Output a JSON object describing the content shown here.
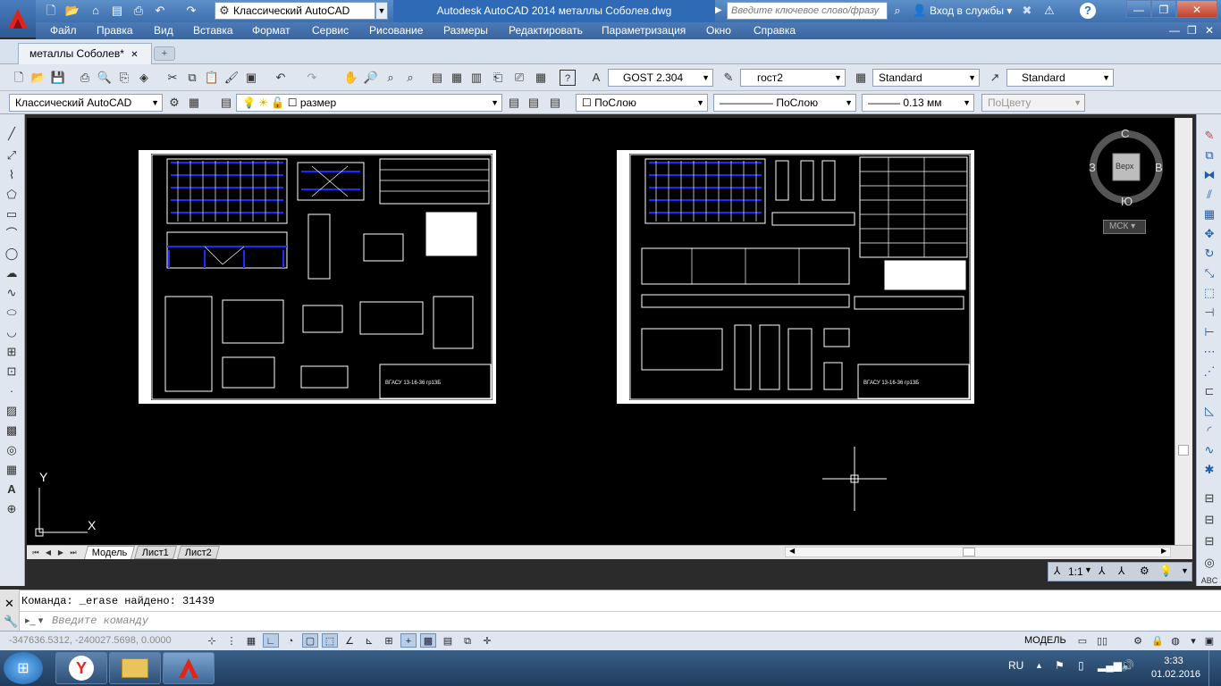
{
  "titlebar": {
    "workspace": "Классический AutoCAD",
    "app_title": "Autodesk AutoCAD 2014    металлы Соболев.dwg",
    "search_placeholder": "Введите ключевое слово/фразу",
    "login": "Вход в службы",
    "help": "?"
  },
  "menu": [
    "Файл",
    "Правка",
    "Вид",
    "Вставка",
    "Формат",
    "Сервис",
    "Рисование",
    "Размеры",
    "Редактировать",
    "Параметризация",
    "Окно",
    "Справка"
  ],
  "doc_tab": "металлы Соболев*",
  "toolbar1": {
    "text_style": "GOST 2.304",
    "dim_style": "гост2",
    "table_style": "Standard",
    "mleader_style": "Standard"
  },
  "toolbar2": {
    "workspace": "Классический AutoCAD",
    "layer": "размер",
    "color": "ПоСлою",
    "linetype": "ПоСлою",
    "lineweight": "0.13 мм",
    "plotstyle": "ПоЦвету"
  },
  "viewcube": {
    "north": "С",
    "south": "Ю",
    "west": "З",
    "east": "В",
    "top": "Верх",
    "ucs": "МСК"
  },
  "ucs_icon": {
    "y": "Y",
    "x": "X"
  },
  "layout_tabs": [
    "Модель",
    "Лист1",
    "Лист2"
  ],
  "annotation": {
    "scale": "1:1"
  },
  "command": {
    "history": "Команда: _erase найдено: 31439",
    "placeholder": "Введите команду"
  },
  "status": {
    "coords": "-347636.5312, -240027.5698, 0.0000",
    "model": "МОДЕЛЬ"
  },
  "taskbar": {
    "lang": "RU",
    "time": "3:33",
    "date": "01.02.2016"
  },
  "sheets": [
    {
      "stamp": "ВГАСУ 13-16-36 гр13Б"
    },
    {
      "stamp": "ВГАСУ 13-16-36 гр13Б"
    }
  ],
  "colors": {
    "titlebar": "#3e6fae",
    "accent": "#2e6ab5",
    "canvas": "#000000",
    "drawing_blue": "#1a2bff"
  }
}
